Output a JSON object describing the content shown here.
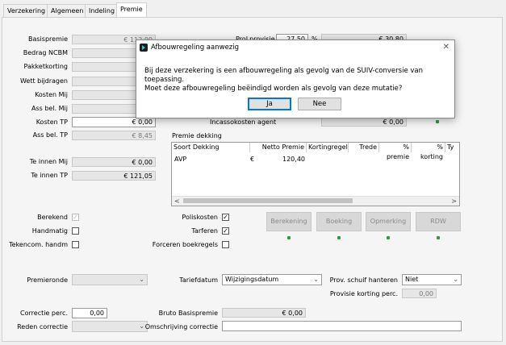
{
  "tabs": [
    "Verzekering",
    "Algemeen",
    "Indeling",
    "Premie"
  ],
  "active_tab": "Premie",
  "left_fields": [
    {
      "label": "Basispremie",
      "value": "€ 112,00"
    },
    {
      "label": "Bedrag NCBM",
      "value": "€"
    },
    {
      "label": "Pakketkorting",
      "value": "€"
    },
    {
      "label": "Wett bijdragen",
      "value": "€"
    },
    {
      "label": "Kosten Mij",
      "value": "€"
    },
    {
      "label": "Ass bel. Mij",
      "value": "€"
    },
    {
      "label": "Kosten TP",
      "value": "€ 0,00"
    },
    {
      "label": "Ass bel. TP",
      "value": "€ 8,45"
    }
  ],
  "te_innen_mij": {
    "label": "Te innen Mij",
    "value": "€ 0,00"
  },
  "te_innen_tp": {
    "label": "Te innen TP",
    "value": "€ 121,05"
  },
  "provisie": {
    "label": "ProLprovisie",
    "percent": "27,50",
    "pct_sign": "%",
    "amount": "€ 30,80"
  },
  "incassokosten": {
    "label": "Incassokosten agent",
    "value": "€ 0,00"
  },
  "premie_dekking": {
    "title": "Premie dekking",
    "columns": [
      "Soort Dekking",
      "Netto Premie",
      "Kortingregel",
      "Trede",
      "% premie",
      "% korting",
      "Ty"
    ],
    "rows": [
      {
        "soort": "AVP",
        "currency": "€",
        "netto": "120,40"
      }
    ],
    "scroll_left": "<",
    "scroll_right": ">"
  },
  "checkboxes_left": [
    {
      "label": "Berekend",
      "checked": true,
      "disabled": true
    },
    {
      "label": "Handmatig",
      "checked": false,
      "disabled": false
    },
    {
      "label": "Tekencom. handm",
      "checked": false,
      "disabled": false
    }
  ],
  "checkboxes_mid": [
    {
      "label": "Poliskosten",
      "checked": true
    },
    {
      "label": "Tarferen",
      "checked": true
    },
    {
      "label": "Forceren boekregels",
      "checked": false
    }
  ],
  "check_mark": "✓",
  "action_buttons": [
    "Berekening",
    "Boeking",
    "Opmerking",
    "RDW"
  ],
  "premieronde": {
    "label": "Premieronde",
    "value": ""
  },
  "tariefdatum": {
    "label": "Tariefdatum",
    "value": "Wijzigingsdatum"
  },
  "prov_schuif": {
    "label": "Prov. schuif hanteren",
    "value": "Niet"
  },
  "provisie_korting": {
    "label": "Provisie korting perc.",
    "value": "0,00"
  },
  "correctie_perc": {
    "label": "Correctie perc.",
    "value": "0,00"
  },
  "reden_correctie": {
    "label": "Reden correctie",
    "value": ""
  },
  "bruto_basispremie": {
    "label": "Bruto Basispremie",
    "value": "€ 0,00"
  },
  "omschrijving_correctie": {
    "label": "Omschrijving correctie",
    "value": ""
  },
  "dialog": {
    "title": "Afbouwregeling aanwezig",
    "line1": "Bij deze verzekering is een afbouwregeling als gevolg van de SUIV-conversie van toepassing.",
    "line2": "Moet deze afbouwregeling beëindigd worden als gevolg van deze mutatie?",
    "yes": "Ja",
    "no": "Nee",
    "close": "✕"
  },
  "chevron": "⌄",
  "colors": {
    "status_dot": "#2e9b3e",
    "default_button_border": "#0078d7"
  }
}
